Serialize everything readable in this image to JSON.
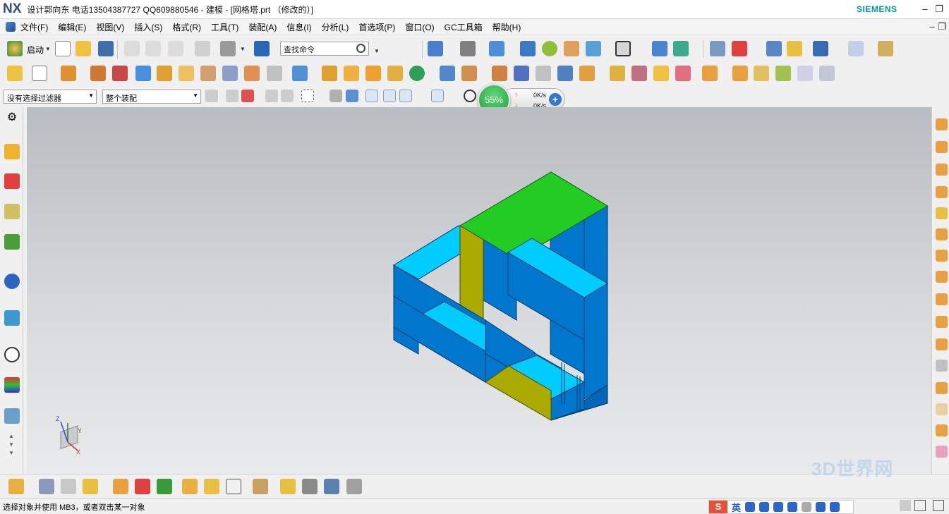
{
  "window": {
    "logo": "NX",
    "title": "设计郭向东  电话13504387727  QQ609880546 - 建模 - [网格塔.prt （修改的）]",
    "brand": "SIEMENS"
  },
  "menu": [
    "文件(F)",
    "编辑(E)",
    "视图(V)",
    "插入(S)",
    "格式(R)",
    "工具(T)",
    "装配(A)",
    "信息(I)",
    "分析(L)",
    "首选项(P)",
    "窗口(O)",
    "GC工具箱",
    "帮助(H)"
  ],
  "toolbar": {
    "start_label": "启动",
    "find_placeholder": "查找命令"
  },
  "filters": {
    "selection_filter": "没有选择过滤器",
    "assembly_scope": "整个装配"
  },
  "speed_widget": {
    "percent": "55%",
    "upload": "0K/s",
    "download": "0K/s"
  },
  "status": {
    "message": "选择对象并使用 MB3，或者双击某一对象"
  },
  "ime": {
    "logo": "S",
    "lang": "英"
  },
  "watermark": "3D世界网",
  "model_colors": {
    "top_green": "#22cc22",
    "light_blue": "#00ccff",
    "mid_blue": "#0077cc",
    "olive": "#aaaa00"
  },
  "triad": {
    "x": "X",
    "y": "Y",
    "z": "Z"
  }
}
